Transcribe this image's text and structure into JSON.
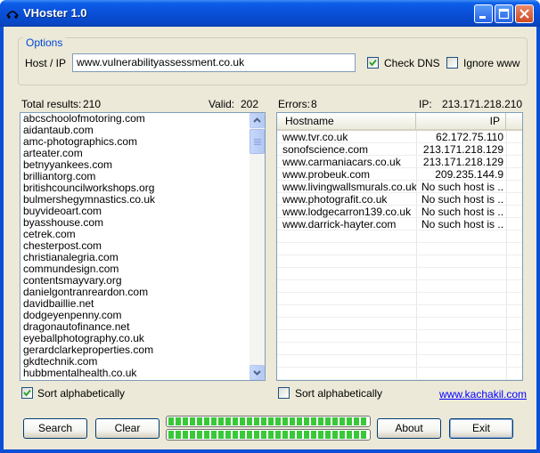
{
  "window": {
    "title": "VHoster 1.0"
  },
  "options": {
    "group_label": "Options",
    "host_label": "Host / IP",
    "host_value": "www.vulnerabilityassessment.co.uk",
    "check_dns_label": "Check DNS",
    "check_dns_checked": true,
    "ignore_www_label": "Ignore www",
    "ignore_www_checked": false
  },
  "stats": {
    "total_label": "Total results:",
    "total_value": "210",
    "valid_label": "Valid:",
    "valid_value": "202",
    "errors_label": "Errors:",
    "errors_value": "8",
    "ip_label": "IP:",
    "ip_value": "213.171.218.210"
  },
  "results_list": {
    "items": [
      "abcschoolofmotoring.com",
      "aidantaub.com",
      "amc-photographics.com",
      "arteater.com",
      "betnyyankees.com",
      "brilliantorg.com",
      "britishcouncilworkshops.org",
      "bulmershegymnastics.co.uk",
      "buyvideoart.com",
      "byasshouse.com",
      "cetrek.com",
      "chesterpost.com",
      "christianalegria.com",
      "commundesign.com",
      "contentsmayvary.org",
      "danielgontranreardon.com",
      "davidbaillie.net",
      "dodgeyenpenny.com",
      "dragonautofinance.net",
      "eyeballphotography.co.uk",
      "gerardclarkeproperties.com",
      "gkdtechnik.com",
      "hubbmentalhealth.co.uk"
    ],
    "sort_label": "Sort alphabetically",
    "sort_checked": true
  },
  "errors_table": {
    "columns": {
      "host": "Hostname",
      "ip": "IP"
    },
    "rows": [
      {
        "host": "www.tvr.co.uk",
        "ip": "62.172.75.110"
      },
      {
        "host": "sonofscience.com",
        "ip": "213.171.218.129"
      },
      {
        "host": "www.carmaniacars.co.uk",
        "ip": "213.171.218.129"
      },
      {
        "host": "www.probeuk.com",
        "ip": "209.235.144.9"
      },
      {
        "host": "www.livingwallsmurals.co.uk",
        "ip": "No such host is ..."
      },
      {
        "host": "www.photografit.co.uk",
        "ip": "No such host is ..."
      },
      {
        "host": "www.lodgecarron139.co.uk",
        "ip": "No such host is ..."
      },
      {
        "host": "www.darrick-hayter.com",
        "ip": "No such host is ..."
      }
    ],
    "sort_label": "Sort alphabetically",
    "sort_checked": false
  },
  "footer": {
    "link": "www.kachakil.com",
    "search_label": "Search",
    "clear_label": "Clear",
    "about_label": "About",
    "exit_label": "Exit",
    "progress_top": 1.0,
    "progress_bottom": 1.0
  },
  "colors": {
    "titlebar": "#0a4fd8",
    "face": "#ece9d8",
    "group_title": "#0046d5",
    "link": "#0000ff",
    "progress": "#38c838"
  }
}
